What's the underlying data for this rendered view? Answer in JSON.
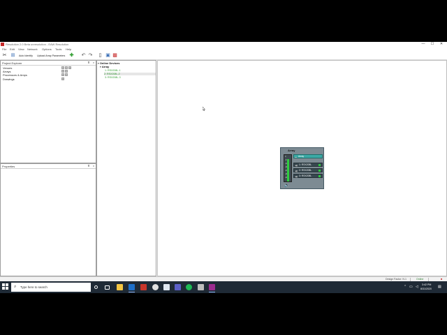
{
  "window": {
    "title": "Resolution 2.0 Beta unresolution - EAW Resolution",
    "controls": {
      "minimize": "—",
      "maximize": "☐",
      "close": "✕"
    }
  },
  "menu": [
    "File",
    "Edit",
    "View",
    "Network",
    "Options",
    "Tools",
    "Help"
  ],
  "toolbar": {
    "auto_identify": "Auto Identify",
    "upload_array_params": "Upload Array Parameters"
  },
  "project_explorer": {
    "title": "Project Explorer",
    "pin": "⊼",
    "close": "×",
    "items": [
      "Venues",
      "Arrays",
      "Processors & Amps",
      "Drawings"
    ]
  },
  "properties": {
    "title": "Properties",
    "pin": "⊼",
    "close": "×"
  },
  "online_devices": {
    "title": "Online Devices",
    "group": "Array",
    "devices": [
      "1: RSX208L-1",
      "2: RSX208L-2",
      "3: RSX208L-3"
    ]
  },
  "array_widget": {
    "title": "Array",
    "header_label": "Array",
    "meter_ticks": [
      "0",
      "-6",
      "-12",
      "-18",
      "-24",
      "-30",
      "-40"
    ],
    "meter_level": 0.85,
    "speakers": [
      "1: RSX208L",
      "2: RSX208L",
      "3: RSX208L"
    ]
  },
  "status": {
    "design_factor": "Design Factor: N.1",
    "online": "Online"
  },
  "taskbar": {
    "search_placeholder": "Type here to search",
    "time": "3:42 PM",
    "date": "8/31/2020"
  },
  "colors": {
    "accent_teal": "#3ba9a5",
    "online_green": "#2e9d2e",
    "taskbar": "#1f2a36"
  }
}
